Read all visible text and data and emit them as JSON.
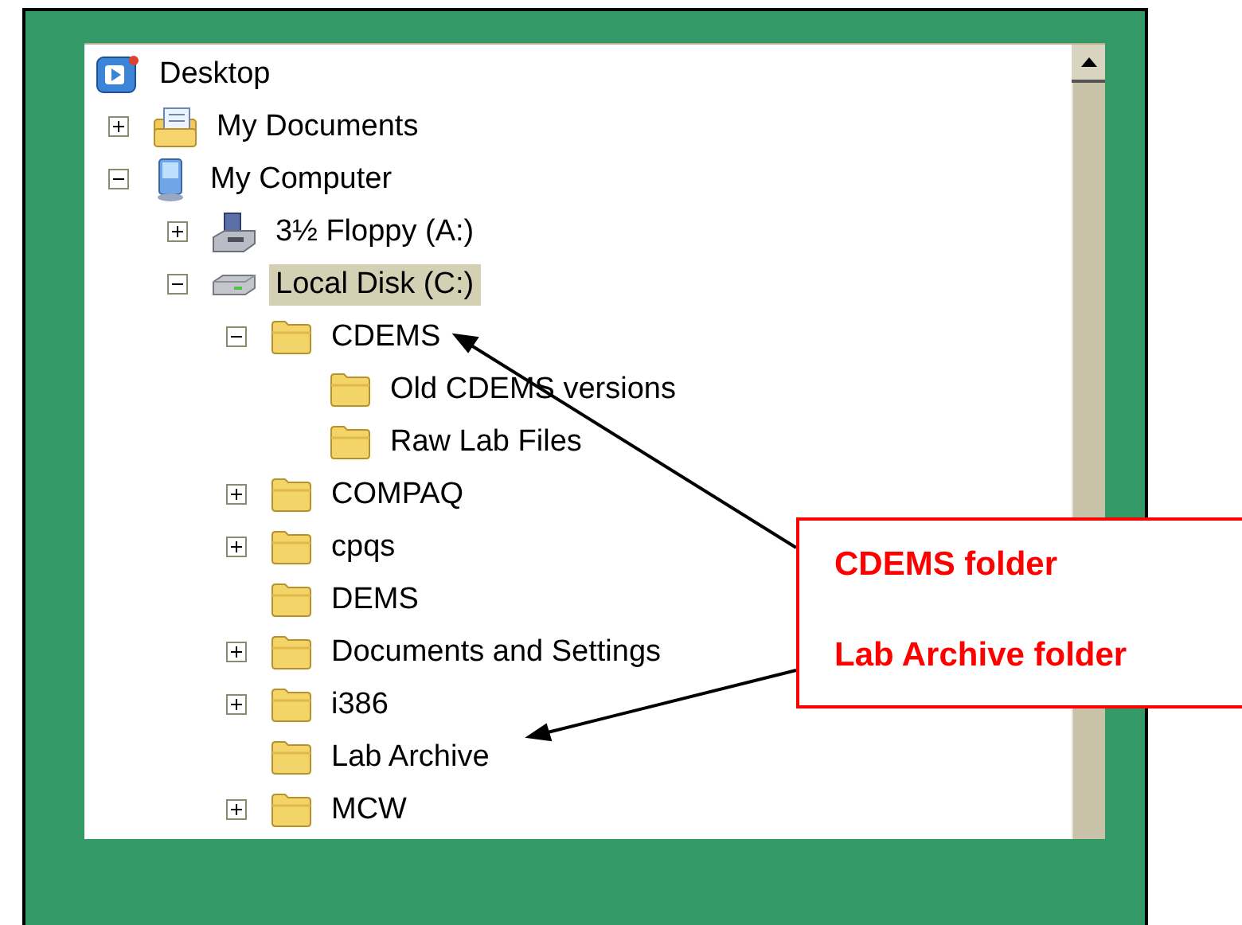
{
  "tree": [
    {
      "label": "Desktop",
      "kind": "desktop",
      "selected": false,
      "children": [
        {
          "label": "My Documents",
          "kind": "documents",
          "selected": false,
          "expanded": false
        },
        {
          "label": "My Computer",
          "kind": "computer",
          "selected": false,
          "expanded": true,
          "children": [
            {
              "label": "3½ Floppy (A:)",
              "kind": "floppy",
              "selected": false,
              "expanded": false
            },
            {
              "label": "Local Disk (C:)",
              "kind": "disk",
              "selected": true,
              "expanded": true,
              "children": [
                {
                  "label": "CDEMS",
                  "kind": "folder",
                  "selected": false,
                  "expanded": true,
                  "children": [
                    {
                      "label": "Old CDEMS versions",
                      "kind": "folder",
                      "selected": false
                    },
                    {
                      "label": "Raw Lab Files",
                      "kind": "folder",
                      "selected": false
                    }
                  ]
                },
                {
                  "label": "COMPAQ",
                  "kind": "folder",
                  "selected": false,
                  "expanded": false
                },
                {
                  "label": "cpqs",
                  "kind": "folder",
                  "selected": false,
                  "expanded": false
                },
                {
                  "label": "DEMS",
                  "kind": "folder",
                  "selected": false
                },
                {
                  "label": "Documents and Settings",
                  "kind": "folder",
                  "selected": false,
                  "expanded": false
                },
                {
                  "label": "i386",
                  "kind": "folder",
                  "selected": false,
                  "expanded": false
                },
                {
                  "label": "Lab Archive",
                  "kind": "folder",
                  "selected": false
                },
                {
                  "label": "MCW",
                  "kind": "folder",
                  "selected": false,
                  "expanded": false
                }
              ]
            }
          ]
        }
      ]
    }
  ],
  "callout": {
    "lines": [
      "CDEMS folder",
      "Lab Archive folder"
    ]
  }
}
